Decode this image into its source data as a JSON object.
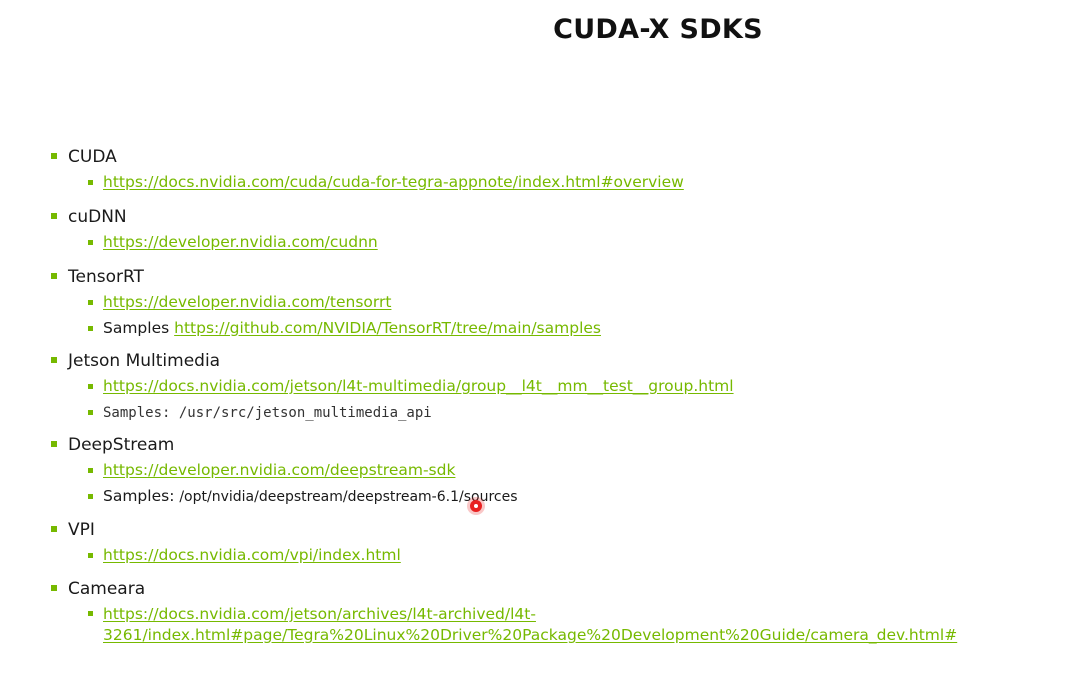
{
  "title": "CUDA-X SDKS",
  "accent_color": "#76b900",
  "sdks": [
    {
      "name": "CUDA",
      "items": [
        {
          "prefix": "",
          "link": "https://docs.nvidia.com/cuda/cuda-for-tegra-appnote/index.html#overview"
        }
      ]
    },
    {
      "name": "cuDNN",
      "items": [
        {
          "prefix": "",
          "link": "https://developer.nvidia.com/cudnn"
        }
      ]
    },
    {
      "name": "TensorRT",
      "items": [
        {
          "prefix": "",
          "link": "https://developer.nvidia.com/tensorrt"
        },
        {
          "prefix": "Samples ",
          "link": "https://github.com/NVIDIA/TensorRT/tree/main/samples"
        }
      ]
    },
    {
      "name": "Jetson Multimedia",
      "items": [
        {
          "prefix": "",
          "link": "https://docs.nvidia.com/jetson/l4t-multimedia/group__l4t__mm__test__group.html"
        },
        {
          "mono_text": "Samples: /usr/src/jetson_multimedia_api"
        }
      ]
    },
    {
      "name": "DeepStream",
      "items": [
        {
          "prefix": "",
          "link": "https://developer.nvidia.com/deepstream-sdk"
        },
        {
          "prefix": "Samples: ",
          "path": "/opt/nvidia/deepstream/deepstream-6.1/sources"
        }
      ]
    },
    {
      "name": "VPI",
      "items": [
        {
          "prefix": "",
          "link": "https://docs.nvidia.com/vpi/index.html"
        }
      ]
    },
    {
      "name": "Cameara",
      "items": [
        {
          "prefix": "",
          "link_line1": "https://docs.nvidia.com/jetson/archives/l4t-archived/l4t-",
          "link_line2": "3261/index.html#page/Tegra%20Linux%20Driver%20Package%20Development%20Guide/camera_dev.html#"
        }
      ]
    }
  ]
}
